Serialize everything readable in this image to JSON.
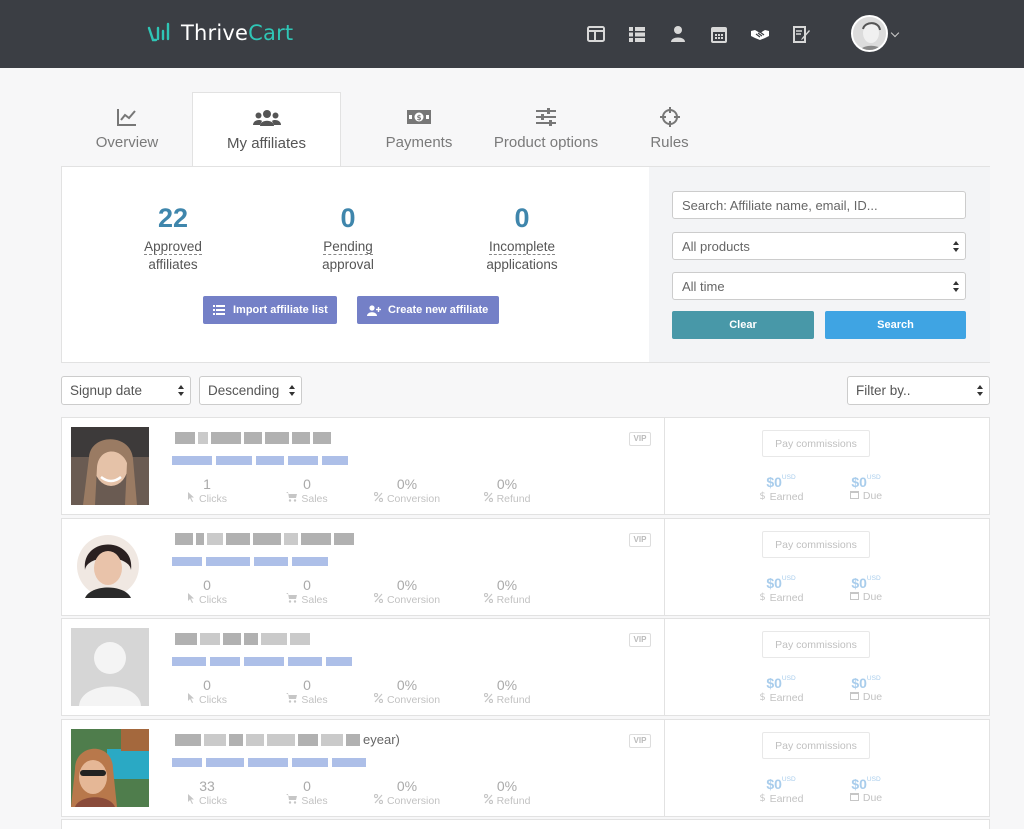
{
  "brand": {
    "name_a": "Thrive",
    "name_b": "Cart"
  },
  "tabs": [
    {
      "label": "Overview",
      "icon": "chart-line-icon"
    },
    {
      "label": "My affiliates",
      "icon": "users-icon"
    },
    {
      "label": "Payments",
      "icon": "money-icon"
    },
    {
      "label": "Product options",
      "icon": "sliders-icon"
    },
    {
      "label": "Rules",
      "icon": "crosshairs-icon"
    }
  ],
  "stats": [
    {
      "value": "22",
      "line1": "Approved",
      "line2": "affiliates"
    },
    {
      "value": "0",
      "line1": "Pending",
      "line2": "approval"
    },
    {
      "value": "0",
      "line1": "Incomplete",
      "line2": "applications"
    }
  ],
  "actions": {
    "import": "Import affiliate list",
    "create": "Create new affiliate"
  },
  "search": {
    "placeholder": "Search: Affiliate name, email, ID...",
    "products": "All products",
    "time": "All time",
    "clear": "Clear",
    "search": "Search"
  },
  "sort": {
    "field": "Signup date",
    "order": "Descending",
    "filter": "Filter by.."
  },
  "row_labels": {
    "vip": "VIP",
    "clicks": "Clicks",
    "sales": "Sales",
    "conversion": "Conversion",
    "refund": "Refund",
    "pay": "Pay commissions",
    "earned": "Earned",
    "due": "Due",
    "usd": "USD"
  },
  "affiliates": [
    {
      "clicks": "1",
      "sales": "0",
      "conversion": "0%",
      "refund": "0%",
      "earned": "$0",
      "due": "$0",
      "name_suffix": ""
    },
    {
      "clicks": "0",
      "sales": "0",
      "conversion": "0%",
      "refund": "0%",
      "earned": "$0",
      "due": "$0",
      "name_suffix": ""
    },
    {
      "clicks": "0",
      "sales": "0",
      "conversion": "0%",
      "refund": "0%",
      "earned": "$0",
      "due": "$0",
      "name_suffix": ""
    },
    {
      "clicks": "33",
      "sales": "0",
      "conversion": "0%",
      "refund": "0%",
      "earned": "$0",
      "due": "$0",
      "name_suffix": "eyear)"
    }
  ],
  "colors": {
    "topbar": "#3b3e44",
    "accent": "#2fc6b6",
    "stat": "#3f86ac",
    "purple": "#7480c7",
    "clear": "#4898a8",
    "search": "#3fa4e3"
  }
}
